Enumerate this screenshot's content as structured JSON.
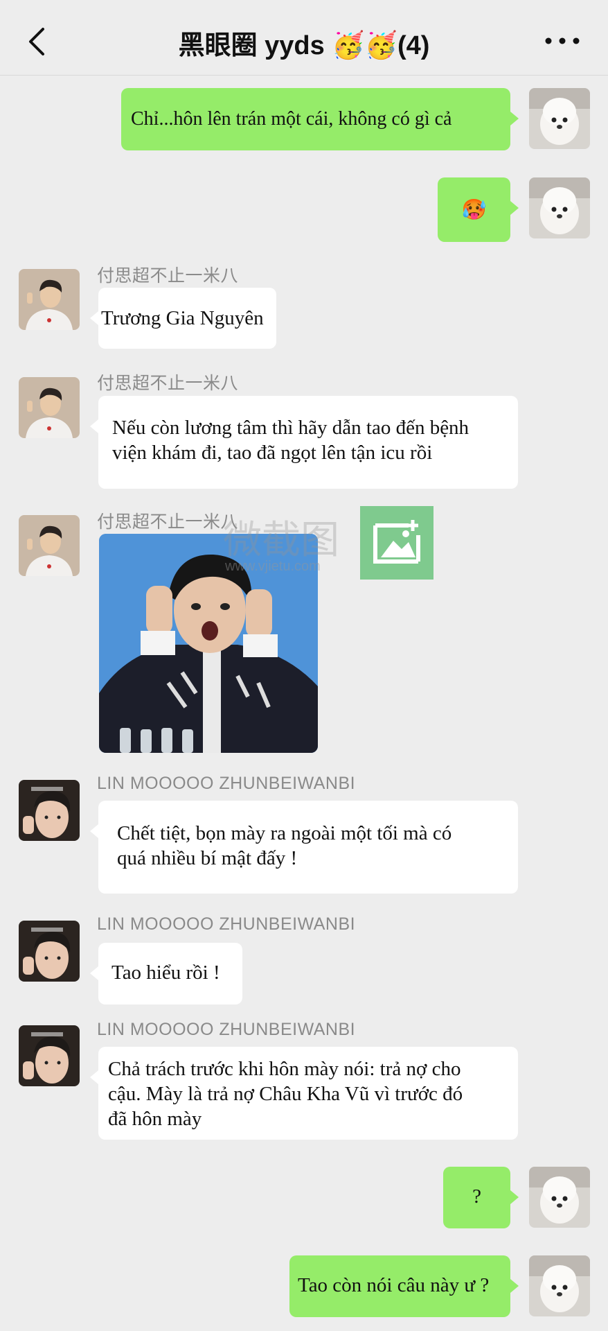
{
  "header": {
    "title": "黑眼圈 yyds 🥳🥳(4)",
    "back_icon": "chevron-left-icon",
    "more_icon": "more-dots-icon"
  },
  "messages": [
    {
      "sender": "me",
      "text": "Chỉ...hôn lên trán một cái, không có gì cả"
    },
    {
      "sender": "me",
      "text": "🥵"
    },
    {
      "sender": "付思超不止一米八",
      "text": "Trương Gia Nguyên"
    },
    {
      "sender": "付思超不止一米八",
      "lines": [
        "Nếu còn lương tâm thì hãy dẫn tao đến bệnh",
        "viện khám đi, tao đã ngọt lên tận icu rồi"
      ]
    },
    {
      "sender": "付思超不止一米八",
      "image": "meme-photo"
    },
    {
      "sender": "LIN MOOOOO ZHUNBEIWANBI",
      "lines": [
        "Chết tiệt, bọn mày ra ngoài một tối mà có",
        "quá nhiều bí mật đấy !"
      ]
    },
    {
      "sender": "LIN MOOOOO ZHUNBEIWANBI",
      "text": "Tao hiểu rồi !"
    },
    {
      "sender": "LIN MOOOOO ZHUNBEIWANBI",
      "lines": [
        "Chả trách trước khi hôn mày nói: trả nợ cho",
        "cậu. Mày là trả nợ Châu Kha Vũ vì trước đó",
        "đã hôn mày"
      ]
    },
    {
      "sender": "me",
      "text": "?"
    },
    {
      "sender": "me",
      "text": "Tao còn nói câu này ư ?"
    }
  ],
  "watermark": {
    "text": "微截图",
    "url": "www.vjietu.com"
  },
  "colors": {
    "outgoing_bubble": "#95ec69",
    "incoming_bubble": "#ffffff",
    "background": "#ededed"
  }
}
